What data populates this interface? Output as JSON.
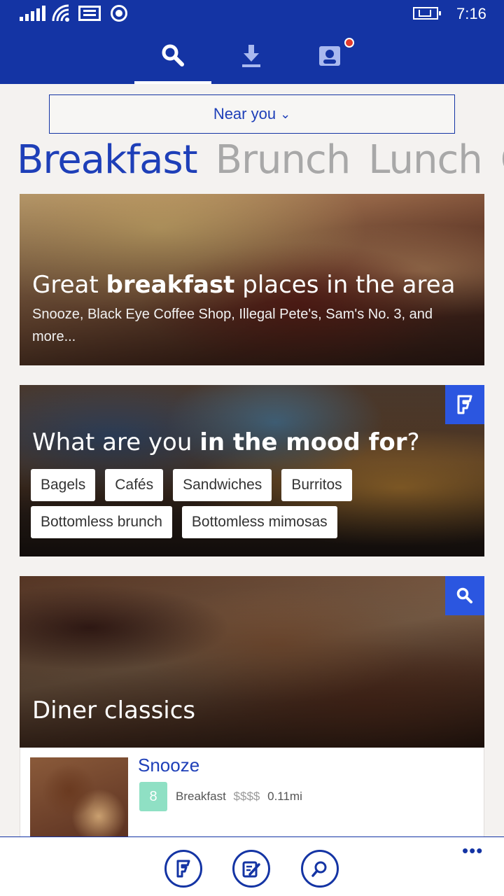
{
  "status_bar": {
    "time": "7:16"
  },
  "tabs": [
    {
      "icon": "search-icon",
      "active": true
    },
    {
      "icon": "download-icon",
      "active": false
    },
    {
      "icon": "profile-icon",
      "active": false,
      "has_notification": true
    }
  ],
  "location_dropdown": {
    "label": "Near you",
    "caret": "⌄"
  },
  "meal_pivot": [
    "Breakfast",
    "Brunch",
    "Lunch",
    "Co"
  ],
  "card_great": {
    "title_pre": "Great ",
    "title_bold": "breakfast",
    "title_post": " places in the area",
    "subtitle": "Snooze, Black Eye Coffee Shop, Illegal Pete's, Sam's No. 3, and more..."
  },
  "card_mood": {
    "title_pre": "What are you ",
    "title_bold": "in the mood for",
    "title_post": "?",
    "badge_icon": "foursquare-icon",
    "chips": [
      "Bagels",
      "Cafés",
      "Sandwiches",
      "Burritos",
      "Bottomless brunch",
      "Bottomless mimosas"
    ]
  },
  "card_diner": {
    "title": "Diner classics",
    "badge_icon": "search-icon"
  },
  "venue": {
    "name": "Snooze",
    "score": "8",
    "category": "Breakfast",
    "price": "$$$$",
    "distance": "0.11mi"
  },
  "app_bar": {
    "buttons": [
      "foursquare-icon",
      "check-in-icon",
      "search-icon"
    ],
    "more": "•••"
  },
  "colors": {
    "brand": "#1434a4",
    "accent": "#2b56e0",
    "score": "#8fe0c4"
  }
}
